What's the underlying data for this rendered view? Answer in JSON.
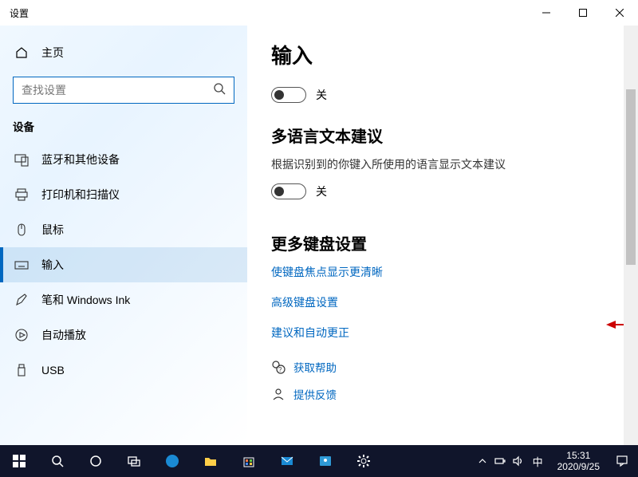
{
  "titlebar": {
    "title": "设置"
  },
  "sidebar": {
    "home": "主页",
    "search_placeholder": "查找设置",
    "group": "设备",
    "items": [
      {
        "label": "蓝牙和其他设备"
      },
      {
        "label": "打印机和扫描仪"
      },
      {
        "label": "鼠标"
      },
      {
        "label": "输入"
      },
      {
        "label": "笔和 Windows Ink"
      },
      {
        "label": "自动播放"
      },
      {
        "label": "USB"
      }
    ]
  },
  "content": {
    "page_title": "输入",
    "toggle1_state": "关",
    "section_multilang": "多语言文本建议",
    "multi_desc": "根据识别到的你键入所使用的语言显示文本建议",
    "toggle2_state": "关",
    "section_more": "更多键盘设置",
    "links": {
      "focus": "使键盘焦点显示更清晰",
      "advanced": "高级键盘设置",
      "suggest": "建议和自动更正"
    },
    "help": "获取帮助",
    "feedback": "提供反馈"
  },
  "taskbar": {
    "ime": "中",
    "time": "15:31",
    "date": "2020/9/25"
  }
}
